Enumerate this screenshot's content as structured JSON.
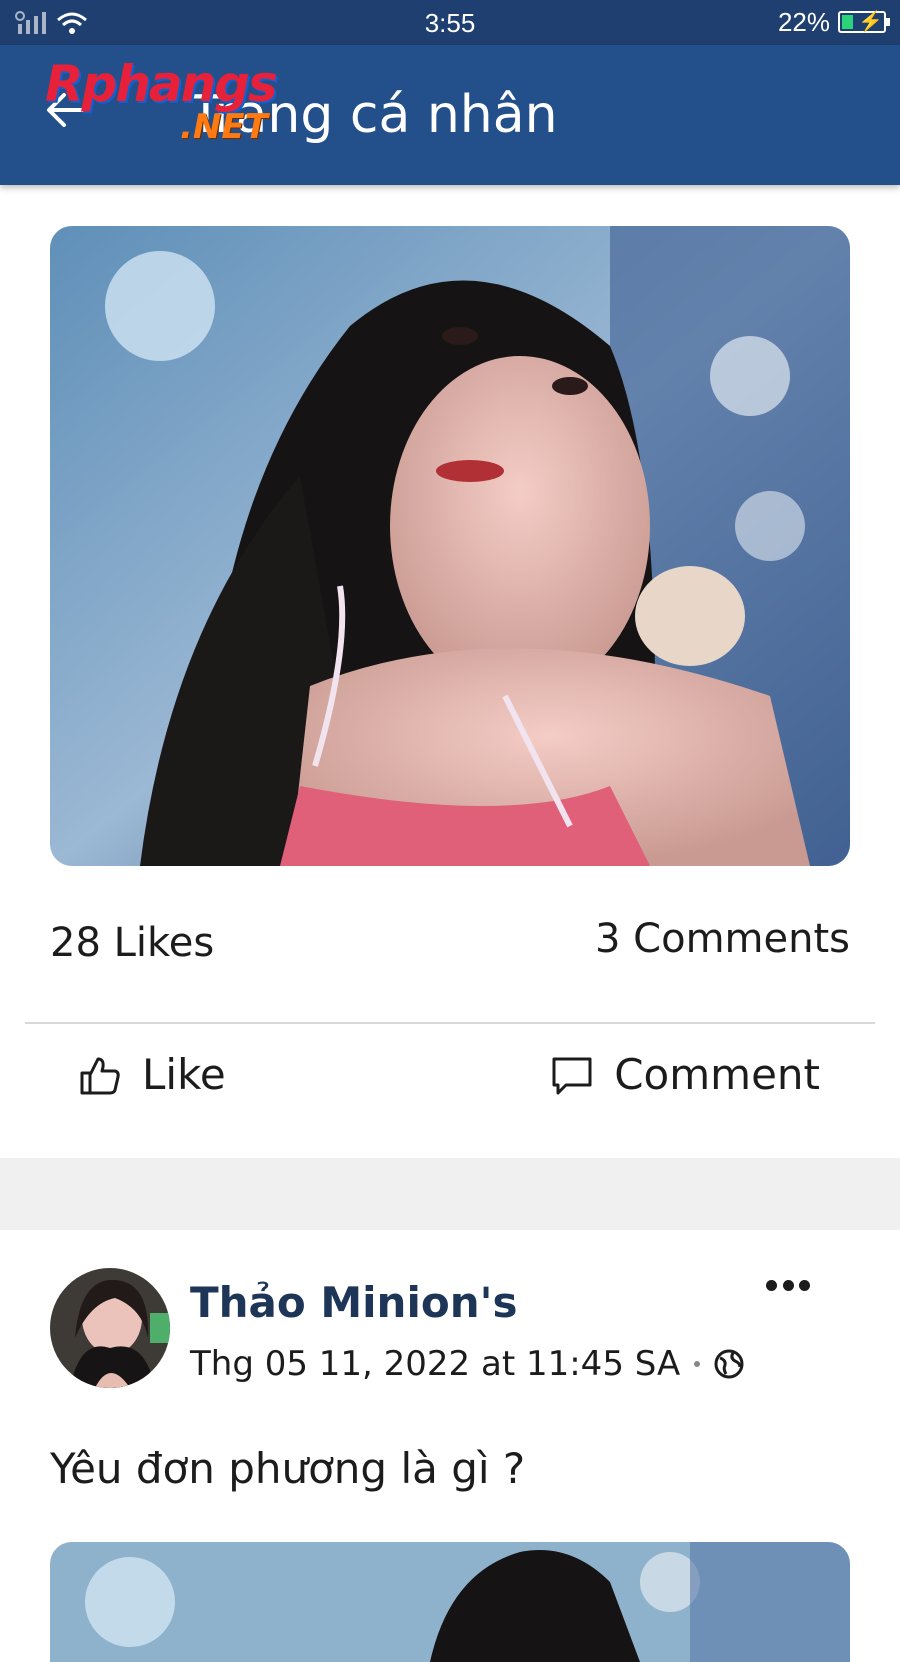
{
  "status": {
    "time": "3:55",
    "battery_percent": "22%"
  },
  "header": {
    "title": "Trang cá nhân",
    "logo_main": "Rphangs",
    "logo_sub": ".NET"
  },
  "post": {
    "likes_label": "28 Likes",
    "comments_label": "3 Comments",
    "like_button": "Like",
    "comment_button": "Comment"
  },
  "next_post": {
    "author": "Thảo Minion's",
    "timestamp": "Thg 05 11, 2022 at 11:45 SA",
    "text": "Yêu đơn phương là gì ?"
  },
  "icons": {
    "back": "arrow-left-icon",
    "like": "thumbs-up-icon",
    "comment": "comment-bubble-icon",
    "privacy": "globe-icon",
    "more": "more-dots-icon"
  },
  "colors": {
    "app_bar": "#234f8b",
    "status_bar": "#1e3f70",
    "author": "#1d3557"
  }
}
